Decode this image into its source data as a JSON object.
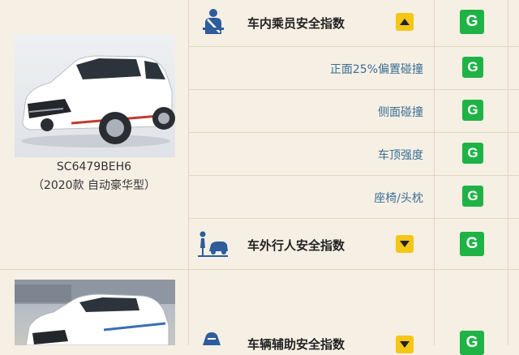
{
  "vehicle1": {
    "model_code": "SC6479BEH6",
    "model_trim": "（2020款 自动豪华型）"
  },
  "sections": {
    "occupant": {
      "label": "车内乘员安全指数",
      "trend": "up",
      "rating": "G"
    },
    "pedestrian": {
      "label": "车外行人安全指数",
      "trend": "down",
      "rating": "G"
    },
    "assist": {
      "label": "车辆辅助安全指数",
      "trend": "down",
      "rating": "G"
    }
  },
  "tests": [
    {
      "label": "正面25%偏置碰撞",
      "rating": "G"
    },
    {
      "label": "侧面碰撞",
      "rating": "G"
    },
    {
      "label": "车顶强度",
      "rating": "G"
    },
    {
      "label": "座椅/头枕",
      "rating": "G"
    }
  ],
  "colors": {
    "rating_good": "#1fb346",
    "arrow": "#f4c715",
    "sub_label": "#3a6e94"
  }
}
